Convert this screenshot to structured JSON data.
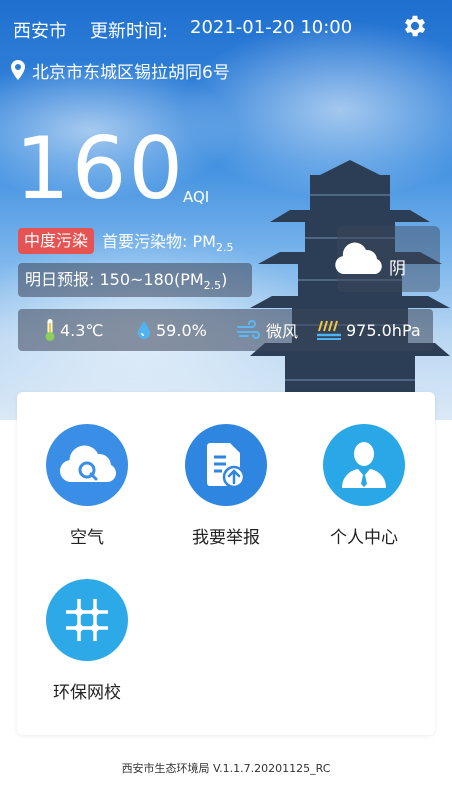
{
  "header": {
    "city": "西安市",
    "update_label": "更新时间:",
    "update_time": "2021-01-20 10:00",
    "settings_icon": "gear-icon"
  },
  "location": {
    "icon": "map-pin-icon",
    "address": "北京市东城区锡拉胡同6号"
  },
  "aqi": {
    "value": "160",
    "unit": "AQI",
    "level_badge": "中度污染",
    "level_color": "#e55353",
    "primary_pollutant_label": "首要污染物: PM",
    "primary_pollutant_sub": "2.5"
  },
  "weather": {
    "icon": "cloud-icon",
    "condition": "阴"
  },
  "forecast": {
    "text": "明日预报: 150~180(PM",
    "sub": "2.5",
    "close": ")"
  },
  "stats": {
    "temperature": "4.3℃",
    "humidity": "59.0%",
    "wind": "微风",
    "pressure": "975.0hPa"
  },
  "menu": [
    {
      "label": "空气",
      "icon": "cloud-search-icon",
      "color": "#3a8ee6"
    },
    {
      "label": "我要举报",
      "icon": "report-upload-icon",
      "color": "#2f86e0"
    },
    {
      "label": "个人中心",
      "icon": "person-icon",
      "color": "#2aa7e6"
    },
    {
      "label": "环保网校",
      "icon": "grid-network-icon",
      "color": "#2ea9e8"
    }
  ],
  "footer": {
    "text": "西安市生态环境局 V.1.1.7.20201125_RC"
  }
}
